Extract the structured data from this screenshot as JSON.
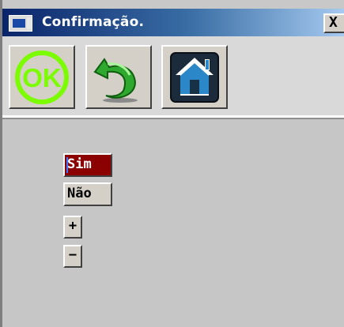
{
  "window": {
    "title": "Confirmação.",
    "close_label": "X",
    "accent_color": "#0a246a"
  },
  "toolbar": {
    "buttons": [
      {
        "icon": "ok-icon",
        "label": "OK"
      },
      {
        "icon": "back-arrow-icon"
      },
      {
        "icon": "home-icon"
      }
    ]
  },
  "options": {
    "items": [
      "Sim",
      "Não"
    ],
    "selected": "Sim",
    "selected_color": "#8b0000",
    "increment_label": "+",
    "decrement_label": "−"
  }
}
